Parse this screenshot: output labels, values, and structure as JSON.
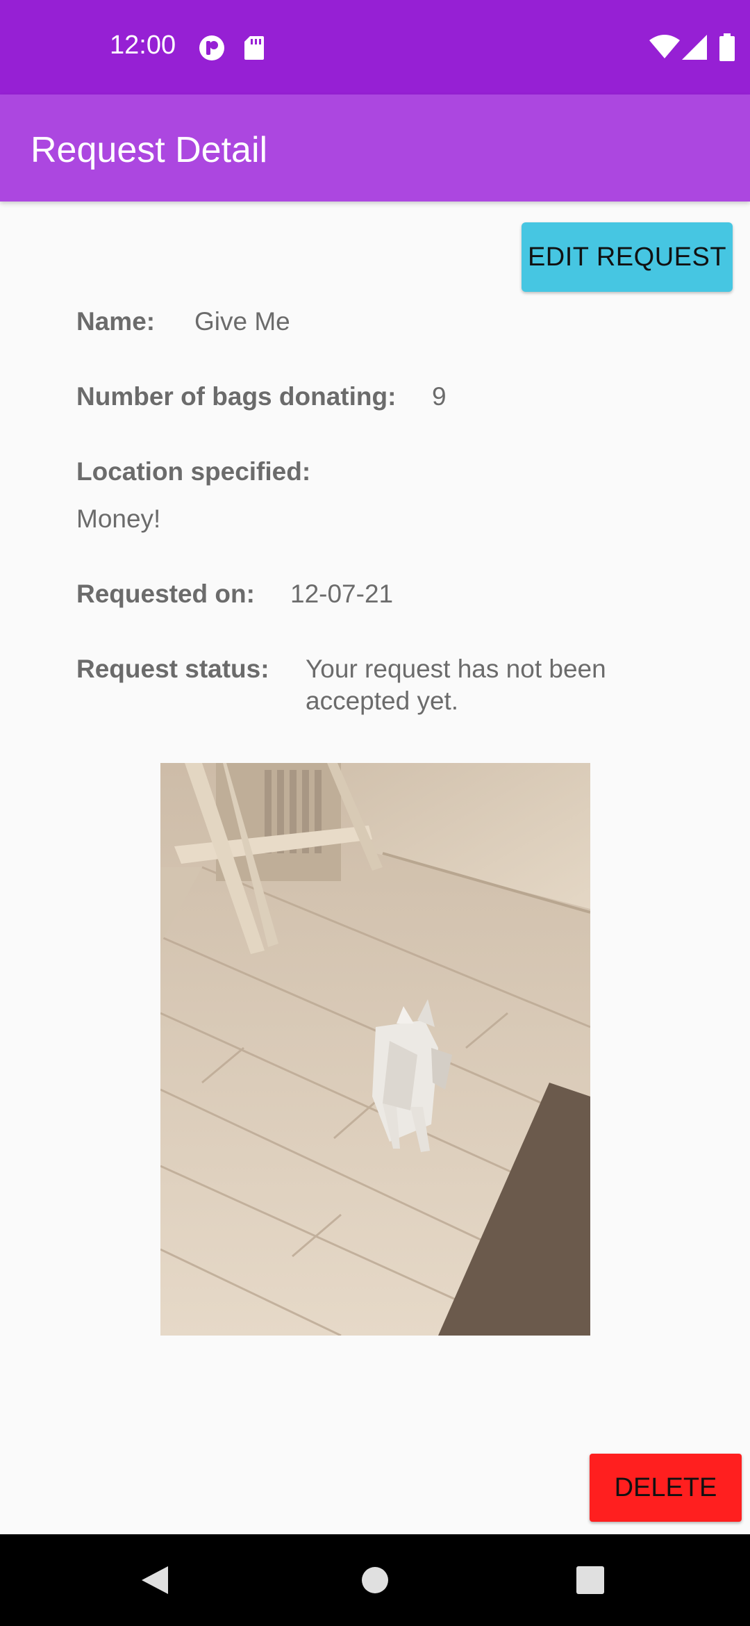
{
  "status_bar": {
    "time": "12:00",
    "icons_left": [
      "notification-icon",
      "sd-card-icon"
    ],
    "icons_right": [
      "wifi-icon",
      "cell-signal-icon",
      "battery-icon"
    ]
  },
  "app_bar": {
    "title": "Request Detail"
  },
  "actions": {
    "edit_label": "EDIT REQUEST",
    "delete_label": "DELETE"
  },
  "details": {
    "name_label": "Name:",
    "name_value": "Give Me",
    "bags_label": "Number of bags donating:",
    "bags_value": "9",
    "location_label": "Location specified:",
    "location_value": "Money!",
    "requested_label": "Requested on:",
    "requested_value": "12-07-21",
    "status_label": "Request status:",
    "status_value_line1": "Your request has not been",
    "status_value_line2": "accepted yet."
  },
  "nav_bar": {
    "icons": [
      "back-icon",
      "home-icon",
      "recents-icon"
    ]
  },
  "colors": {
    "status_bar": "#9620d4",
    "app_bar": "#ac47e0",
    "edit_button": "#46c6e2",
    "delete_button": "#ff1f1f"
  }
}
